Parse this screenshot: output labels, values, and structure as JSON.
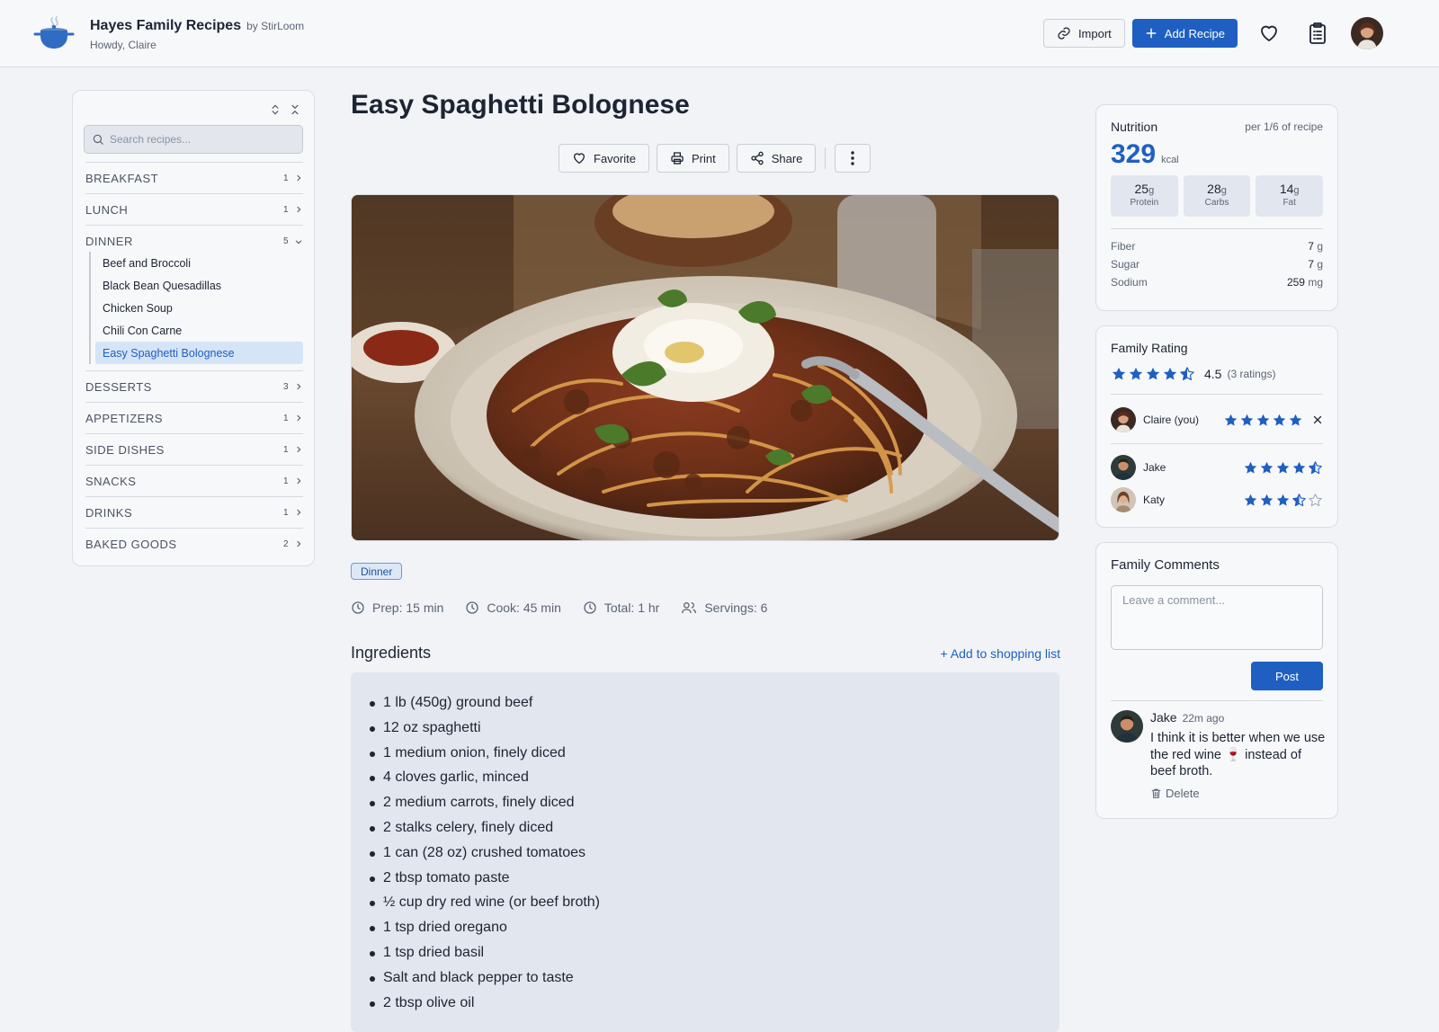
{
  "header": {
    "title": "Hayes Family Recipes",
    "by": "by StirLoom",
    "greeting": "Howdy, Claire",
    "import_label": "Import",
    "add_label": "Add Recipe"
  },
  "sidebar": {
    "search_placeholder": "Search recipes...",
    "categories": [
      {
        "name": "BREAKFAST",
        "count": "1"
      },
      {
        "name": "LUNCH",
        "count": "1"
      },
      {
        "name": "DINNER",
        "count": "5",
        "items": [
          "Beef and Broccoli",
          "Black Bean Quesadillas",
          "Chicken Soup",
          "Chili Con Carne",
          "Easy Spaghetti Bolognese"
        ]
      },
      {
        "name": "DESSERTS",
        "count": "3"
      },
      {
        "name": "APPETIZERS",
        "count": "1"
      },
      {
        "name": "SIDE DISHES",
        "count": "1"
      },
      {
        "name": "SNACKS",
        "count": "1"
      },
      {
        "name": "DRINKS",
        "count": "1"
      },
      {
        "name": "BAKED GOODS",
        "count": "2"
      }
    ]
  },
  "recipe": {
    "title": "Easy Spaghetti Bolognese",
    "actions": {
      "favorite": "Favorite",
      "print": "Print",
      "share": "Share"
    },
    "tag": "Dinner",
    "prep": "Prep: 15 min",
    "cook": "Cook: 45 min",
    "total": "Total: 1 hr",
    "servings": "Servings: 6",
    "ingredients_title": "Ingredients",
    "add_to_list": "+ Add to shopping list",
    "ingredients": [
      "1 lb (450g) ground beef",
      "12 oz spaghetti",
      "1 medium onion, finely diced",
      "4 cloves garlic, minced",
      "2 medium carrots, finely diced",
      "2 stalks celery, finely diced",
      "1 can (28 oz) crushed tomatoes",
      "2 tbsp tomato paste",
      "½ cup dry red wine (or beef broth)",
      "1 tsp dried oregano",
      "1 tsp dried basil",
      "Salt and black pepper to taste",
      "2 tbsp olive oil"
    ]
  },
  "nutrition": {
    "title": "Nutrition",
    "per": "per 1/6 of recipe",
    "kcal": "329",
    "kcal_unit": "kcal",
    "protein": "25",
    "protein_label": "Protein",
    "carbs": "28",
    "carbs_label": "Carbs",
    "fat": "14",
    "fat_label": "Fat",
    "macro_unit": "g",
    "rows": [
      {
        "label": "Fiber",
        "value": "7",
        "unit": "g"
      },
      {
        "label": "Sugar",
        "value": "7",
        "unit": "g"
      },
      {
        "label": "Sodium",
        "value": "259",
        "unit": "mg"
      }
    ]
  },
  "rating": {
    "title": "Family Rating",
    "average": "4.5",
    "count": "(3 ratings)",
    "raters": [
      {
        "name": "Claire (you)",
        "stars": 5
      },
      {
        "name": "Jake",
        "stars": 4.5
      },
      {
        "name": "Katy",
        "stars": 3.5
      }
    ]
  },
  "comments": {
    "title": "Family Comments",
    "placeholder": "Leave a comment...",
    "post_label": "Post",
    "items": [
      {
        "author": "Jake",
        "time": "22m ago",
        "text": "I think it is better when we use the red wine 🍷 instead of beef broth.",
        "delete_label": "Delete"
      }
    ]
  },
  "colors": {
    "accent": "#1f5fc2",
    "background": "#f1f3f7",
    "star": "#1f5fc2"
  }
}
